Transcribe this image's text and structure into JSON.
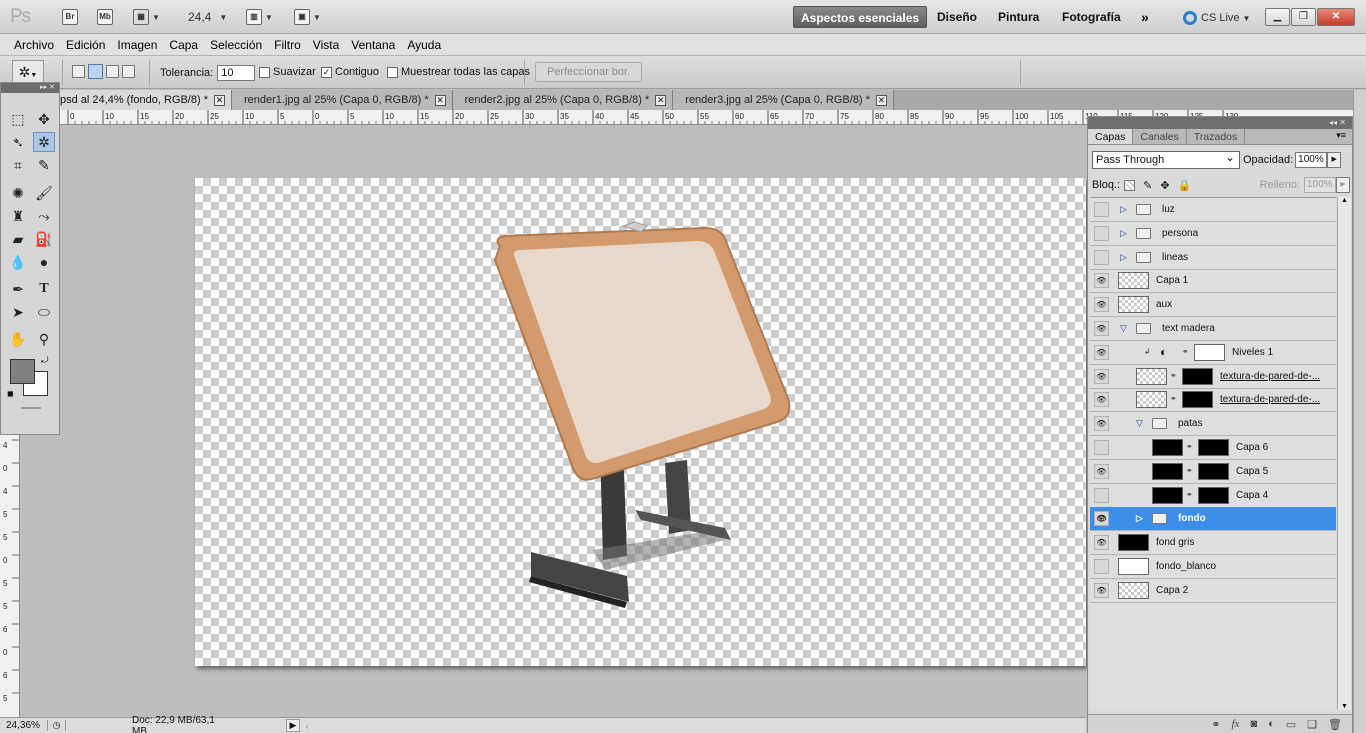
{
  "app": {
    "logo": "Ps",
    "zoom": "24,4",
    "bridge": "Br",
    "minibridge": "Mb"
  },
  "workspaces": [
    "Aspectos esenciales",
    "Diseño",
    "Pintura",
    "Fotografía"
  ],
  "more_workspaces": "»",
  "cs_live": "CS Live",
  "menu": [
    "Archivo",
    "Edición",
    "Imagen",
    "Capa",
    "Selección",
    "Filtro",
    "Vista",
    "Ventana",
    "Ayuda"
  ],
  "options": {
    "tolerance_label": "Tolerancia:",
    "tolerance_value": "10",
    "antialias_label": "Suavizar",
    "contiguous_label": "Contiguo",
    "sample_all_label": "Muestrear todas las capas",
    "refine_edge_label": "Perfeccionar bor."
  },
  "tabs": [
    {
      "label": "psd al 24,4% (fondo, RGB/8) *",
      "active": true
    },
    {
      "label": "render1.jpg al 25% (Capa 0, RGB/8) *",
      "active": false
    },
    {
      "label": "render2.jpg al 25% (Capa 0, RGB/8) *",
      "active": false
    },
    {
      "label": "render3.jpg al 25% (Capa 0, RGB/8) *",
      "active": false
    }
  ],
  "ruler_top": [
    "0",
    "10",
    "15",
    "20",
    "25",
    "10",
    "5",
    "0",
    "5",
    "10",
    "15",
    "20",
    "25",
    "30",
    "35",
    "40",
    "45",
    "50",
    "55",
    "60",
    "65",
    "70",
    "75",
    "80",
    "85",
    "90",
    "95",
    "100",
    "105",
    "110",
    "115",
    "120",
    "125",
    "130"
  ],
  "ruler_left": [
    "4",
    "0",
    "4",
    "5",
    "5",
    "0",
    "5",
    "5",
    "6",
    "0",
    "6",
    "5"
  ],
  "status": {
    "zoom": "24,36%",
    "doc": "Doc: 22,9 MB/63,1 MB"
  },
  "layers_panel": {
    "tabs": [
      "Capas",
      "Canales",
      "Trazados"
    ],
    "blend_mode": "Pass Through",
    "opacity_label": "Opacidad:",
    "opacity_value": "100%",
    "lock_label": "Bloq.:",
    "fill_label": "Relleno:",
    "fill_value": "100%",
    "layers": [
      {
        "name": "luz",
        "type": "group",
        "visible": false,
        "indent": 0,
        "expanded": false
      },
      {
        "name": "persona",
        "type": "group",
        "visible": false,
        "indent": 0,
        "expanded": false
      },
      {
        "name": "lineas",
        "type": "group",
        "visible": false,
        "indent": 0,
        "expanded": false
      },
      {
        "name": "Capa 1",
        "type": "layer",
        "visible": true,
        "indent": 0,
        "thumb": "checker"
      },
      {
        "name": "aux",
        "type": "layer",
        "visible": true,
        "indent": 0,
        "thumb": "checker"
      },
      {
        "name": "text madera",
        "type": "group",
        "visible": true,
        "indent": 0,
        "expanded": true
      },
      {
        "name": "Niveles 1",
        "type": "adjustment",
        "visible": true,
        "indent": 1
      },
      {
        "name": "textura-de-pared-de-...",
        "type": "masked",
        "visible": true,
        "indent": 1
      },
      {
        "name": "textura-de-pared-de-...",
        "type": "masked",
        "visible": true,
        "indent": 1
      },
      {
        "name": "patas",
        "type": "group",
        "visible": true,
        "indent": 1,
        "expanded": true
      },
      {
        "name": "Capa 6",
        "type": "masked-black",
        "visible": false,
        "indent": 2
      },
      {
        "name": "Capa 5",
        "type": "masked-black",
        "visible": true,
        "indent": 2
      },
      {
        "name": "Capa 4",
        "type": "masked-black",
        "visible": false,
        "indent": 2
      },
      {
        "name": "fondo",
        "type": "group",
        "visible": true,
        "indent": 1,
        "expanded": false,
        "selected": true
      },
      {
        "name": "fond gris",
        "type": "layer",
        "visible": true,
        "indent": 0,
        "thumb": "black"
      },
      {
        "name": "fondo_blanco",
        "type": "layer",
        "visible": false,
        "indent": 0,
        "thumb": "white"
      },
      {
        "name": "Capa 2",
        "type": "layer",
        "visible": true,
        "indent": 0,
        "thumb": "checker"
      }
    ]
  },
  "colors": {
    "accent": "#3d8ee8",
    "foreground": "#808080",
    "background": "#ffffff",
    "frame_wood": "#d39a6e"
  }
}
